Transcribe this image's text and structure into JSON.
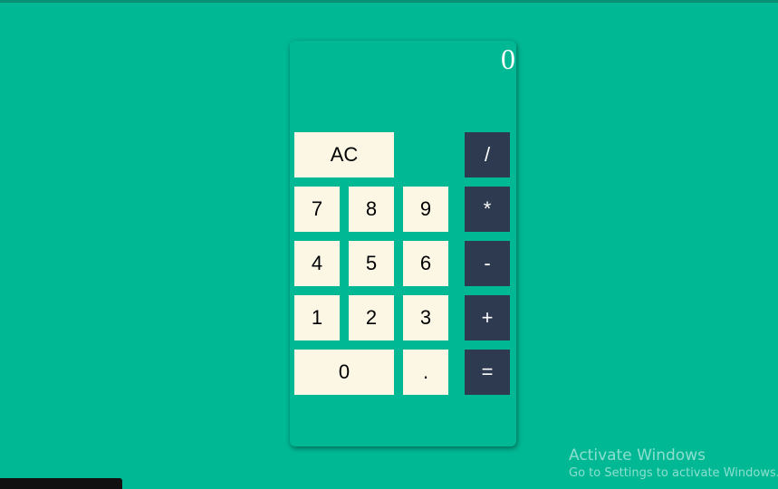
{
  "calculator": {
    "display": "0",
    "keys": {
      "clear": "AC",
      "divide": "/",
      "seven": "7",
      "eight": "8",
      "nine": "9",
      "multiply": "*",
      "four": "4",
      "five": "5",
      "six": "6",
      "subtract": "-",
      "one": "1",
      "two": "2",
      "three": "3",
      "add": "+",
      "zero": "0",
      "decimal": ".",
      "equals": "="
    }
  },
  "watermark": {
    "title": "Activate Windows",
    "subtitle": "Go to Settings to activate Windows."
  },
  "colors": {
    "background": "#00b894",
    "number_key": "#fbf7e4",
    "operator_key": "#2d3a4f"
  }
}
